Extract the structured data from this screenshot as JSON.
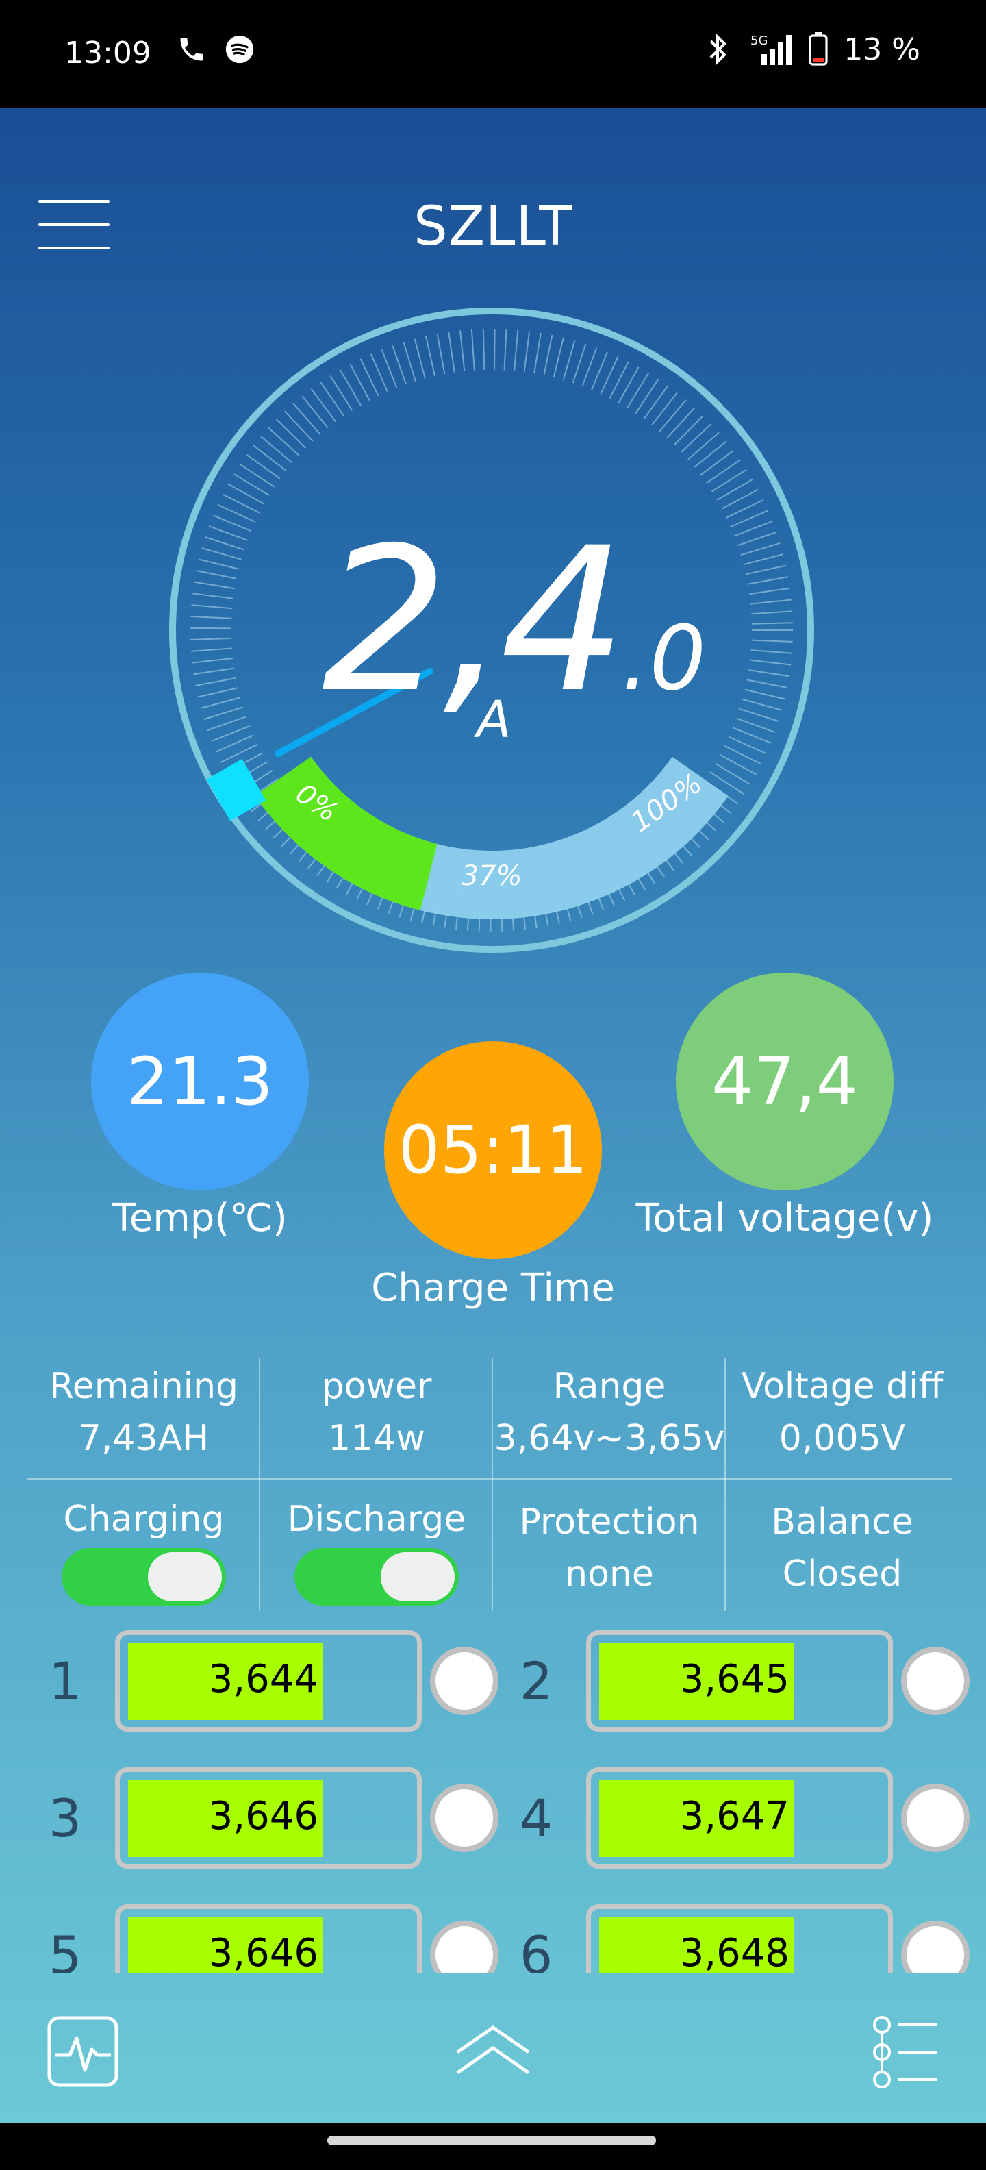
{
  "status_bar": {
    "time": "13:09",
    "battery": "13 %",
    "network": "5G"
  },
  "app": {
    "title": "SZLLT"
  },
  "gauge": {
    "value_main": "2,4",
    "value_dec": ".0",
    "unit": "A",
    "percent": 37,
    "percent_label": "37%",
    "min_label": "0%",
    "max_label": "100%"
  },
  "circles": {
    "temp": {
      "value": "21.3",
      "label": "Temp(℃)",
      "color": "#44a3f6"
    },
    "charge_time": {
      "value": "05:11",
      "label": "Charge Time",
      "color": "#ffa504"
    },
    "total_voltage": {
      "value": "47,4",
      "label": "Total voltage(v)",
      "color": "#7ecd7a"
    }
  },
  "stats": [
    {
      "label": "Remaining",
      "value": "7,43AH"
    },
    {
      "label": "power",
      "value": "114w"
    },
    {
      "label": "Range",
      "value": "3,64v~3,65v"
    },
    {
      "label": "Voltage diff",
      "value": "0,005V"
    }
  ],
  "controls": {
    "charging": {
      "label": "Charging",
      "on": true
    },
    "discharge": {
      "label": "Discharge",
      "on": true
    },
    "protection": {
      "label": "Protection",
      "value": "none"
    },
    "balance": {
      "label": "Balance",
      "value": "Closed"
    }
  },
  "cells": [
    {
      "id": "1",
      "value": "3,644"
    },
    {
      "id": "2",
      "value": "3,645"
    },
    {
      "id": "3",
      "value": "3,646"
    },
    {
      "id": "4",
      "value": "3,647"
    },
    {
      "id": "5",
      "value": "3,646"
    },
    {
      "id": "6",
      "value": "3,648"
    }
  ],
  "colors": {
    "accent_green": "#a8ff00",
    "toggle_on": "#32d046",
    "gauge_fill": "#5ee61c"
  }
}
